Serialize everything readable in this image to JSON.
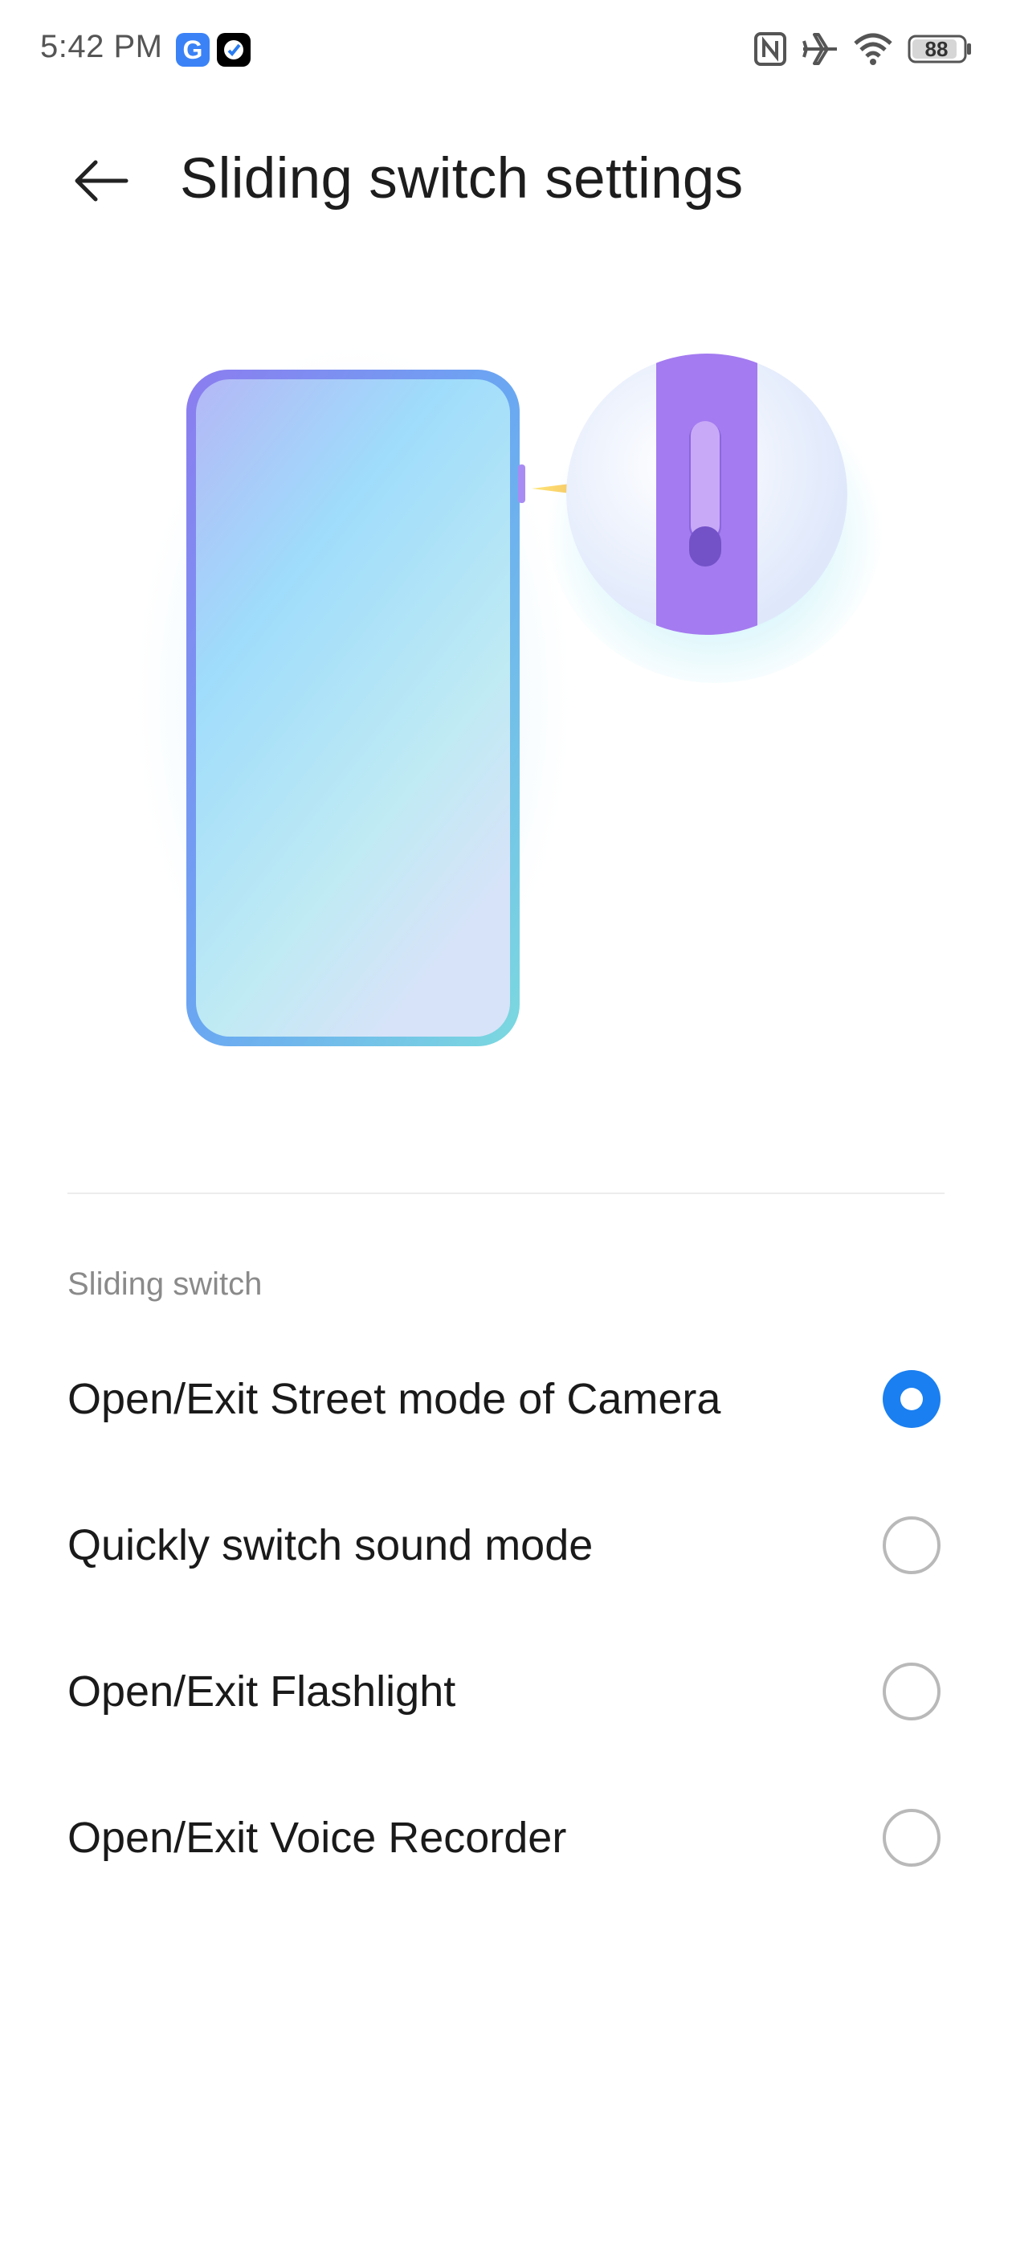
{
  "status_bar": {
    "time": "5:42 PM",
    "apps": [
      "google-app-icon",
      "news-app-icon"
    ],
    "icons": [
      "nfc-icon",
      "airplane-mode-icon",
      "wifi-icon",
      "battery-icon"
    ],
    "battery_level": "88"
  },
  "header": {
    "title": "Sliding switch settings",
    "back_icon": "arrow-left-icon"
  },
  "section": {
    "label": "Sliding switch"
  },
  "options": [
    {
      "label": "Open/Exit Street mode of Camera",
      "selected": true
    },
    {
      "label": "Quickly switch sound mode",
      "selected": false
    },
    {
      "label": "Open/Exit Flashlight",
      "selected": false
    },
    {
      "label": "Open/Exit Voice Recorder",
      "selected": false
    }
  ],
  "colors": {
    "accent": "#1a7ff0",
    "radio_off": "#b9b9b9",
    "arrow": "#f8a640",
    "switch_purple": "#a374ef"
  }
}
